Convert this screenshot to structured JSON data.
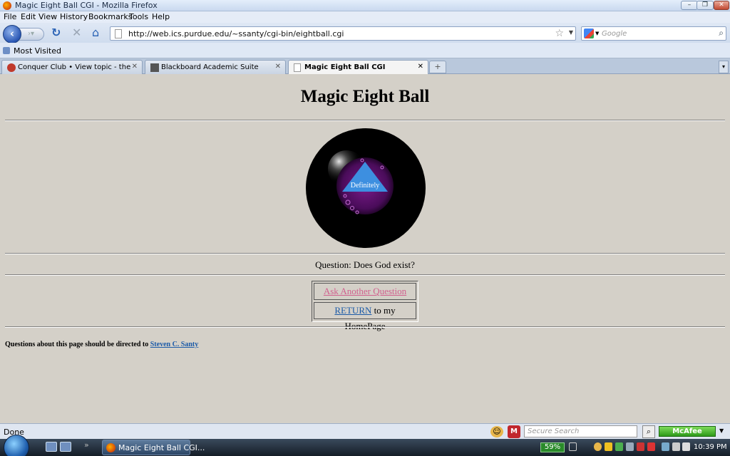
{
  "window": {
    "title": "Magic Eight Ball CGI - Mozilla Firefox",
    "min": "–",
    "max": "❐",
    "close": "✕"
  },
  "menu": [
    "File",
    "Edit",
    "View",
    "History",
    "Bookmarks",
    "Tools",
    "Help"
  ],
  "nav": {
    "url": "http://web.ics.purdue.edu/~ssanty/cgi-bin/eightball.cgi",
    "search_placeholder": "Google"
  },
  "bookmarks": {
    "most_visited": "Most Visited"
  },
  "tabs": [
    {
      "label": "Conquer Club • View topic - the lon...",
      "active": false
    },
    {
      "label": "Blackboard Academic Suite",
      "active": false
    },
    {
      "label": "Magic Eight Ball CGI",
      "active": true
    }
  ],
  "tab_new": "+",
  "page": {
    "heading": "Magic Eight Ball",
    "answer": "Definitely",
    "question": "Question: Does God exist?",
    "ask_link": "Ask Another Question",
    "return_link": "RETURN",
    "return_suffix": " to my HomePage",
    "footer_text": "Questions about this page should be directed to ",
    "footer_link": "Steven C. Santy"
  },
  "colors": {
    "page_bg": "#d4d0c8",
    "link": "#1c5ba8",
    "visited_link": "#d1608e",
    "triangle": "#3d8fe0"
  },
  "status": {
    "text": "Done",
    "secure_search": "Secure Search",
    "mcafee": "McAfee"
  },
  "taskbar": {
    "firefox_task": "Magic Eight Ball CGI...",
    "battery": "59%",
    "clock": "10:39 PM"
  }
}
